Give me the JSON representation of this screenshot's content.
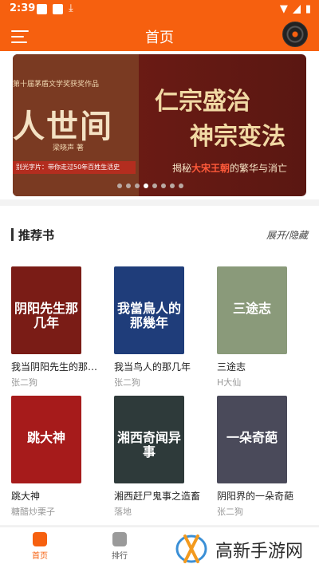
{
  "status_bar": {
    "time": "2:39",
    "download_glyph": "⤓",
    "wifi_glyph": "▼",
    "battery_glyph": "▮"
  },
  "app_bar": {
    "title": "首页",
    "menu_icon": "menu-icon",
    "music_icon": "vinyl-disc-icon"
  },
  "banner": {
    "award_text": "第十届茅盾文学奖获奖作品",
    "left_title": "人世间",
    "author_text": "梁晓声 著",
    "slogan": "别光字片：带你走过50年百姓生活史",
    "right_title_1": "仁宗盛治",
    "right_title_2": "神宗变法",
    "right_sub_pre": "揭秘",
    "right_sub_highlight": "大宋王朝",
    "right_sub_post": "的繁华与消亡",
    "dots_total": 8,
    "active_dot": 3
  },
  "recommend": {
    "title": "推荐书",
    "toggle": "展开/隐藏",
    "books": [
      {
        "name": "我当阴阳先生的那几年",
        "author": "张二狗",
        "cover_text": "阴阳先生那几年",
        "cover_color": "#7a1c16"
      },
      {
        "name": "我当鸟人的那几年",
        "author": "张二狗",
        "cover_text": "我當鳥人的那幾年",
        "cover_color": "#1f3d7a"
      },
      {
        "name": "三途志",
        "author": "H大仙",
        "cover_text": "三途志",
        "cover_color": "#8a9a7a"
      },
      {
        "name": "跳大神",
        "author": "糖醋炒栗子",
        "cover_text": "跳大神",
        "cover_color": "#a61b1b"
      },
      {
        "name": "湘西赶尸鬼事之造畜",
        "author": "落地",
        "cover_text": "湘西奇闻异事",
        "cover_color": "#2e3a3a"
      },
      {
        "name": "阴阳界的一朵奇葩",
        "author": "张二狗",
        "cover_text": "一朵奇葩",
        "cover_color": "#4a4a5a"
      }
    ]
  },
  "bottom_nav": {
    "home": "首页",
    "rank": "排行"
  },
  "watermark": {
    "text": "高新手游网"
  },
  "colors": {
    "accent": "#f6600f"
  }
}
